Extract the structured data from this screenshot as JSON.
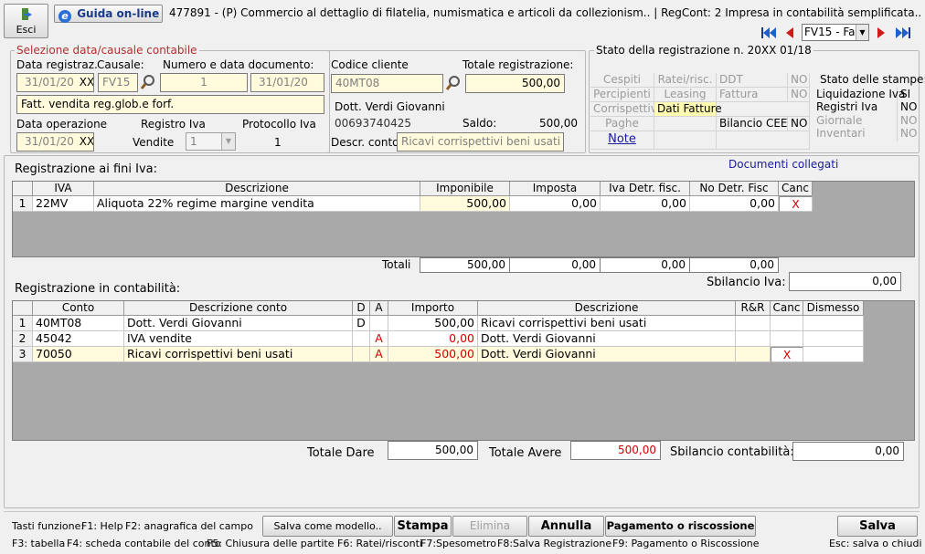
{
  "toolbar": {
    "exit_label": "Esci",
    "guide_label": "Guida on-line",
    "title": "477891 - (P) Commercio al dettaglio di filatelia, numismatica e articoli da collezionism.. | RegCont: 2 Impresa  in contabilità semplificata.."
  },
  "nav": {
    "selector_value": "FV15 - Fa"
  },
  "selection": {
    "group_title": "Selezione data/causale contabile",
    "date_reg_label": "Data registraz.",
    "date_reg_value": "31/01/20",
    "date_reg_suffix": "XX",
    "causale_label": "Causale:",
    "causale_value": "FV15",
    "doc_label": "Numero e data documento:",
    "doc_number": "1",
    "doc_date": "31/01/20",
    "description": "Fatt. vendita reg.glob.e forf.",
    "date_op_label": "Data operazione",
    "date_op_value": "31/01/20",
    "date_op_suffix": "XX",
    "registro_label": "Registro Iva",
    "registro_value": "Vendite",
    "registro_number": "1",
    "protocollo_label": "Protocollo Iva",
    "protocollo_value": "1"
  },
  "client": {
    "code_label": "Codice cliente",
    "code_value": "40MT08",
    "total_label": "Totale registrazione:",
    "total_value": "500,00",
    "name": "Dott.  Verdi Giovanni",
    "vat": "00693740425",
    "saldo_label": "Saldo:",
    "saldo_value": "500,00",
    "descr_label": "Descr. conto",
    "descr_value": "Ricavi corrispettivi beni usati"
  },
  "status": {
    "title": "Stato della registrazione n. 20XX 01/18",
    "cespiti": "Cespiti",
    "ratei": "Ratei/risc.",
    "ddt": "DDT",
    "ddt_val": "NO",
    "percipienti": "Percipienti",
    "leasing": "Leasing",
    "fattura": "Fattura",
    "fattura_val": "NO",
    "corrispettivi": "Corrispettivi",
    "dati_fatture": "Dati Fatture",
    "paghe": "Paghe",
    "bilancio": "Bilancio CEE",
    "bilancio_val": "NO",
    "note": "Note",
    "stampe_title": "Stato delle stampe:",
    "liquidazione": "Liquidazione Iva",
    "liquidazione_val": "SI",
    "registri": "Registri Iva",
    "registri_val": "NO",
    "giornale": "Giornale",
    "giornale_val": "NO",
    "inventari": "Inventari",
    "inventari_val": "NO"
  },
  "iva_section": {
    "title": "Registrazione ai fini Iva:",
    "linked_docs": "Documenti collegati",
    "headers": [
      "IVA",
      "Descrizione",
      "Imponibile",
      "Imposta",
      "Iva Detr. fisc.",
      "No Detr. Fisc",
      "Canc"
    ],
    "rows": [
      {
        "n": "1",
        "iva": "22MV",
        "descr": "Aliquota 22% regime margine vendita",
        "imponibile": "500,00",
        "imposta": "0,00",
        "detr": "0,00",
        "nodetr": "0,00",
        "canc": "X"
      }
    ],
    "totals_label": "Totali",
    "totals": [
      "500,00",
      "0,00",
      "0,00",
      "0,00"
    ],
    "sbilancio_label": "Sbilancio Iva:",
    "sbilancio_value": "0,00"
  },
  "cont_section": {
    "title": "Registrazione in contabilità:",
    "headers": [
      "Conto",
      "Descrizione conto",
      "D",
      "A",
      "Importo",
      "Descrizione",
      "R&R",
      "Canc",
      "Dismesso"
    ],
    "rows": [
      {
        "n": "1",
        "conto": "40MT08",
        "descr_conto": "Dott.  Verdi Giovanni",
        "d": "D",
        "a": "",
        "importo": "500,00",
        "descr": "Ricavi corrispettivi beni usati",
        "canc": ""
      },
      {
        "n": "2",
        "conto": "45042",
        "descr_conto": "IVA vendite",
        "d": "",
        "a": "A",
        "importo": "0,00",
        "descr": "Dott.  Verdi Giovanni",
        "canc": ""
      },
      {
        "n": "3",
        "conto": "70050",
        "descr_conto": "Ricavi corrispettivi beni usati",
        "d": "",
        "a": "A",
        "importo": "500,00",
        "descr": "Dott.  Verdi Giovanni",
        "canc": "X"
      }
    ],
    "dare_label": "Totale Dare",
    "dare_value": "500,00",
    "avere_label": "Totale Avere",
    "avere_value": "500,00",
    "sbilancio_label": "Sbilancio contabilità:",
    "sbilancio_value": "0,00"
  },
  "footer": {
    "keys_title": "Tasti funzione:",
    "f1": "F1: Help",
    "f2": "F2: anagrafica del campo",
    "f3": "F3: tabella",
    "f4": "F4: scheda contabile del conto",
    "f5": "F5: Chiusura delle partite",
    "f6": "F6: Ratei/risconti",
    "f7": "F7:Spesometro",
    "f8": "F8:Salva Registrazione",
    "f9": "F9: Pagamento o Riscossione",
    "esc": "Esc: salva o chiudi",
    "btn_model": "Salva come modello..",
    "btn_stampa": "Stampa",
    "btn_elimina": "Elimina",
    "btn_annulla": "Annulla",
    "btn_pagamento": "Pagamento o riscossione",
    "btn_salva": "Salva"
  }
}
